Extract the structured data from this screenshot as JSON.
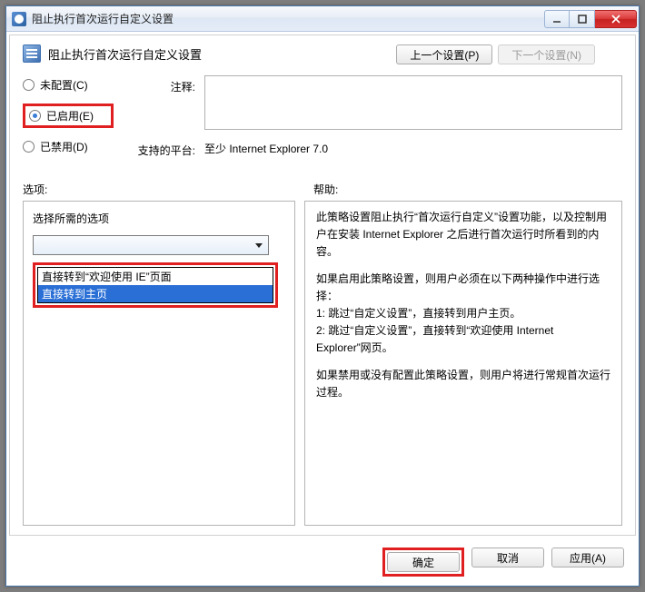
{
  "window": {
    "title": "阻止执行首次运行自定义设置"
  },
  "header": {
    "title": "阻止执行首次运行自定义设置",
    "prev_label": "上一个设置(P)",
    "next_label": "下一个设置(N)"
  },
  "state": {
    "not_configured": "未配置(C)",
    "enabled": "已启用(E)",
    "disabled": "已禁用(D)",
    "selected": "enabled"
  },
  "info": {
    "comment_label": "注释:",
    "comment_value": "",
    "platform_label": "支持的平台:",
    "platform_value": "至少 Internet Explorer 7.0"
  },
  "mid": {
    "options_label": "选项:",
    "help_label": "帮助:"
  },
  "options": {
    "field_label": "选择所需的选项",
    "selected_index": 1,
    "items": [
      "直接转到“欢迎使用 IE”页面",
      "直接转到主页"
    ]
  },
  "help": {
    "p1": "此策略设置阻止执行“首次运行自定义”设置功能，以及控制用户在安装 Internet Explorer 之后进行首次运行时所看到的内容。",
    "p2": "如果启用此策略设置，则用户必须在以下两种操作中进行选择：",
    "l1": "1: 跳过“自定义设置”，直接转到用户主页。",
    "l2": "2: 跳过“自定义设置”，直接转到“欢迎使用 Internet Explorer”网页。",
    "p3": "如果禁用或没有配置此策略设置，则用户将进行常规首次运行过程。"
  },
  "footer": {
    "ok": "确定",
    "cancel": "取消",
    "apply": "应用(A)"
  }
}
